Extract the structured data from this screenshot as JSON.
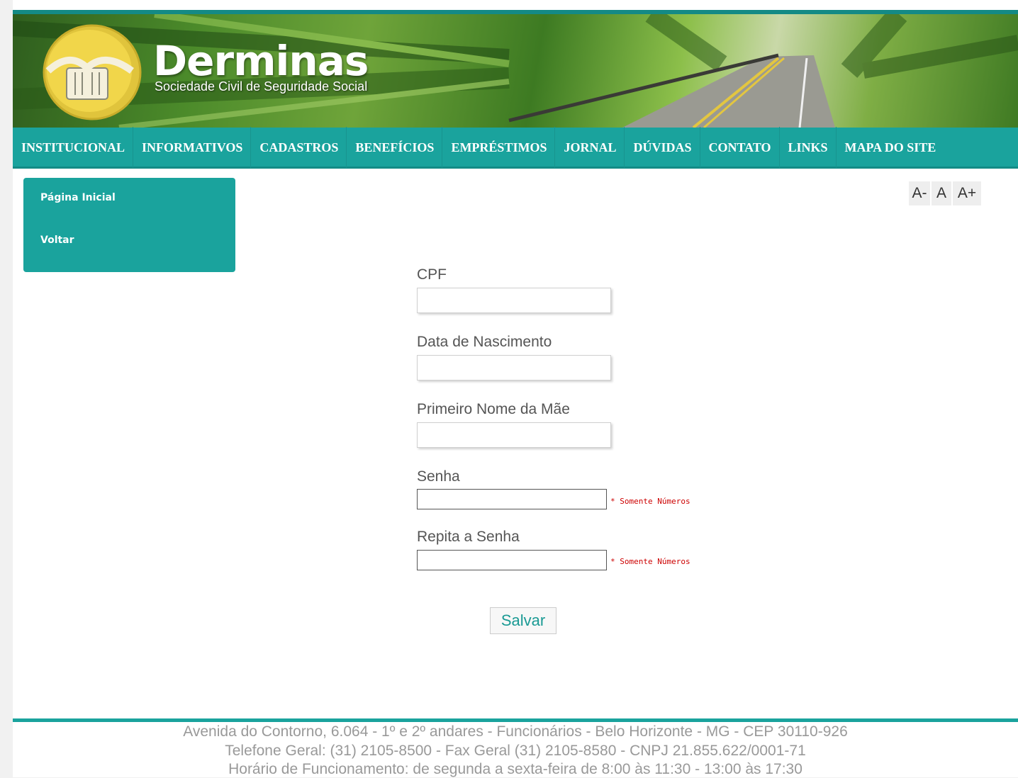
{
  "brand": {
    "name": "Derminas",
    "tagline": "Sociedade Civil de Seguridade Social",
    "accent_color": "#1aa39d"
  },
  "nav": {
    "items": [
      {
        "label": "INSTITUCIONAL"
      },
      {
        "label": "INFORMATIVOS"
      },
      {
        "label": "CADASTROS"
      },
      {
        "label": "BENEFÍCIOS"
      },
      {
        "label": "EMPRÉSTIMOS"
      },
      {
        "label": "JORNAL"
      },
      {
        "label": "DÚVIDAS"
      },
      {
        "label": "CONTATO"
      },
      {
        "label": "LINKS"
      },
      {
        "label": "MAPA DO SITE"
      }
    ]
  },
  "sidebar": {
    "items": [
      {
        "label": "Página Inicial"
      },
      {
        "label": "Voltar"
      }
    ]
  },
  "font_controls": {
    "decrease": "A-",
    "normal": "A",
    "increase": "A+"
  },
  "form": {
    "cpf_label": "CPF",
    "cpf_value": "",
    "birth_label": "Data de Nascimento",
    "birth_value": "",
    "mother_label": "Primeiro Nome da Mãe",
    "mother_value": "",
    "password_label": "Senha",
    "password_value": "",
    "password_hint": "* Somente Números",
    "repeat_label": "Repita a Senha",
    "repeat_value": "",
    "repeat_hint": "* Somente Números",
    "save_label": "Salvar"
  },
  "footer": {
    "address": "Avenida do Contorno, 6.064 - 1º e 2º andares - Funcionários - Belo Horizonte - MG - CEP 30110-926",
    "phones": "Telefone Geral: (31) 2105-8500 - Fax Geral (31) 2105-8580 - CNPJ 21.855.622/0001-71",
    "hours": "Horário de Funcionamento: de segunda a sexta-feira de 8:00 às 11:30 - 13:00 às 17:30"
  }
}
